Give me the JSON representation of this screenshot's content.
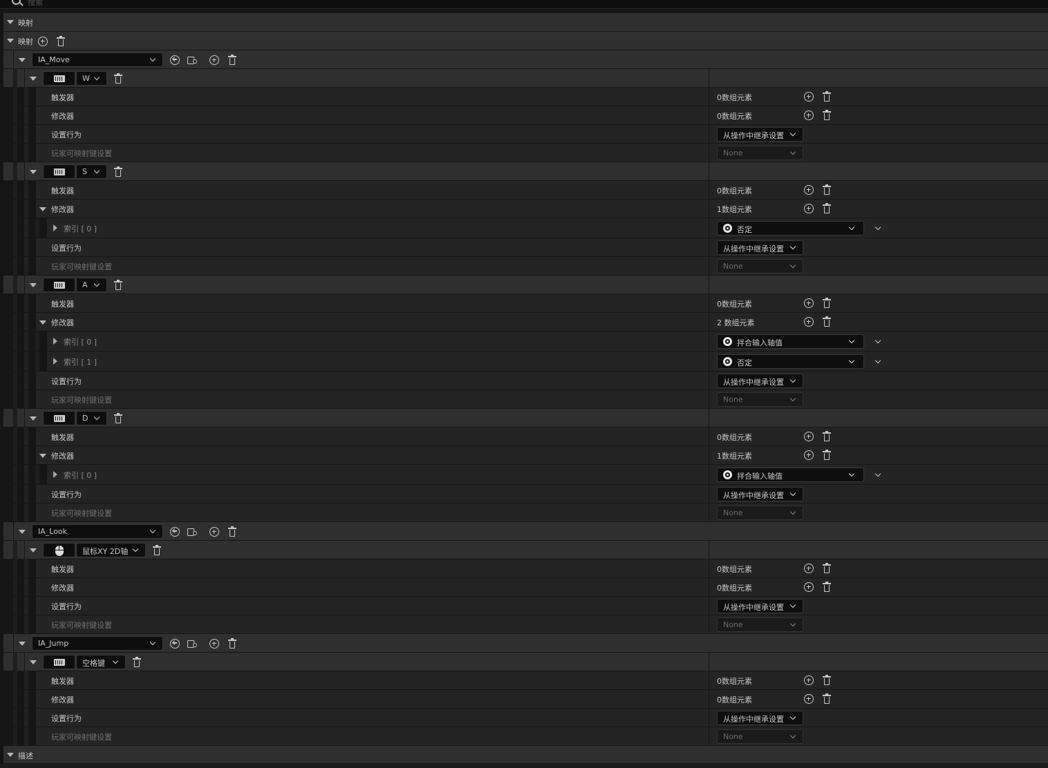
{
  "search": {
    "placeholder": "搜索"
  },
  "sections": {
    "mappings": "映射",
    "description": "描述"
  },
  "mappings_label": "映射",
  "labels": {
    "triggers": "触发器",
    "modifiers": "修改器",
    "settings_behavior": "设置行为",
    "player_mappable": "玩家可映射键设置"
  },
  "actions": [
    {
      "name": "IA_Move",
      "keys": [
        {
          "key": "W",
          "icon": "keyboard-icon",
          "triggers": "0数组元素",
          "modifiers": "0数组元素",
          "behavior": "从操作中继承设置",
          "mappable": "None",
          "items": []
        },
        {
          "key": "S",
          "icon": "keyboard-icon",
          "triggers": "0数组元素",
          "modifiers": "1数组元素",
          "behavior": "从操作中继承设置",
          "mappable": "None",
          "items": [
            {
              "index": "索引 [ 0 ]",
              "value": "否定"
            }
          ]
        },
        {
          "key": "A",
          "icon": "keyboard-icon",
          "triggers": "0数组元素",
          "modifiers": "2 数组元素",
          "behavior": "从操作中继承设置",
          "mappable": "None",
          "items": [
            {
              "index": "索引 [ 0 ]",
              "value": "拌合输入轴值"
            },
            {
              "index": "索引 [ 1 ]",
              "value": "否定"
            }
          ]
        },
        {
          "key": "D",
          "icon": "keyboard-icon",
          "triggers": "0数组元素",
          "modifiers": "1数组元素",
          "behavior": "从操作中继承设置",
          "mappable": "None",
          "items": [
            {
              "index": "索引 [ 0 ]",
              "value": "拌合输入轴值"
            }
          ]
        }
      ]
    },
    {
      "name": "IA_Look",
      "keys": [
        {
          "key": "鼠标XY 2D轴",
          "icon": "mouse-icon",
          "triggers": "0数组元素",
          "modifiers": "0数组元素",
          "behavior": "从操作中继承设置",
          "mappable": "None",
          "items": []
        }
      ]
    },
    {
      "name": "IA_Jump",
      "keys": [
        {
          "key": "空格键",
          "icon": "keyboard-icon",
          "triggers": "0数组元素",
          "modifiers": "0数组元素",
          "behavior": "从操作中继承设置",
          "mappable": "None",
          "items": []
        }
      ]
    }
  ]
}
